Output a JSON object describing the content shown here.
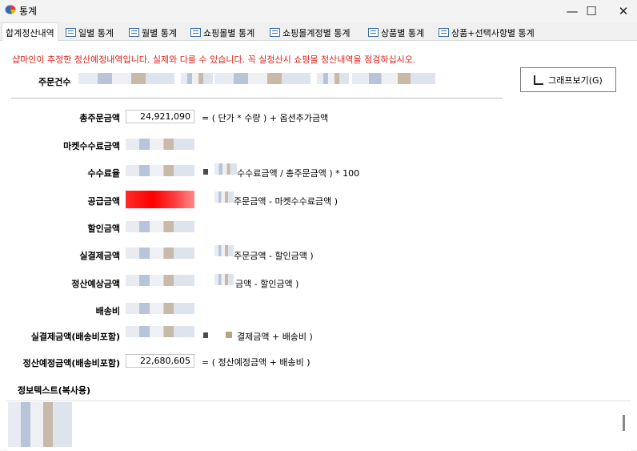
{
  "window": {
    "title": "통계",
    "minimize": "—",
    "maximize": "☐",
    "close": "✕"
  },
  "tabs": [
    {
      "label": "합계정산내역",
      "active": true
    },
    {
      "label": "일별 통계"
    },
    {
      "label": "월별 통계"
    },
    {
      "label": "쇼핑몰별 통계"
    },
    {
      "label": "쇼핑몰계정별 통계"
    },
    {
      "label": "상품별 통계"
    },
    {
      "label": "상품+선택사항별 통계"
    }
  ],
  "notice": "샵마인이 추정한 정산예정내역입니다. 실제와 다를 수 있습니다. 꼭 실정산시 쇼핑몰 정산내역을 점검하십시오.",
  "order_count_label": "주문건수",
  "graph_button": "그래프보기(G)",
  "rows": {
    "total_order": {
      "label": "총주문금액",
      "value": "24,921,090",
      "formula": "= (  단가    *    수량  ) +  옵션추가금액"
    },
    "market_fee": {
      "label": "마켓수수료금액"
    },
    "fee_rate": {
      "label": "수수료율",
      "formula": "수수료금액     /     총주문금액  ) * 100"
    },
    "supply": {
      "label": "공급금액",
      "formula": "주문금액    -    마켓수수료금액  )"
    },
    "discount": {
      "label": "할인금액"
    },
    "actual_pay": {
      "label": "실결제금액",
      "formula": "주문금액    -    할인금액  )"
    },
    "settle_expected": {
      "label": "정산예상금액",
      "formula": "금액    -    할인금액  )"
    },
    "shipping": {
      "label": "배송비"
    },
    "actual_pay_ship": {
      "label": "실결제금액(배송비포함)",
      "formula": "결제금액     +    배송비  )"
    },
    "settle_ship": {
      "label": "정산예정금액(배송비포함)",
      "value": "22,680,605",
      "formula": "= (  정산예정금액    +    배송비  )"
    }
  },
  "info_label": "정보텍스트(복사용)"
}
